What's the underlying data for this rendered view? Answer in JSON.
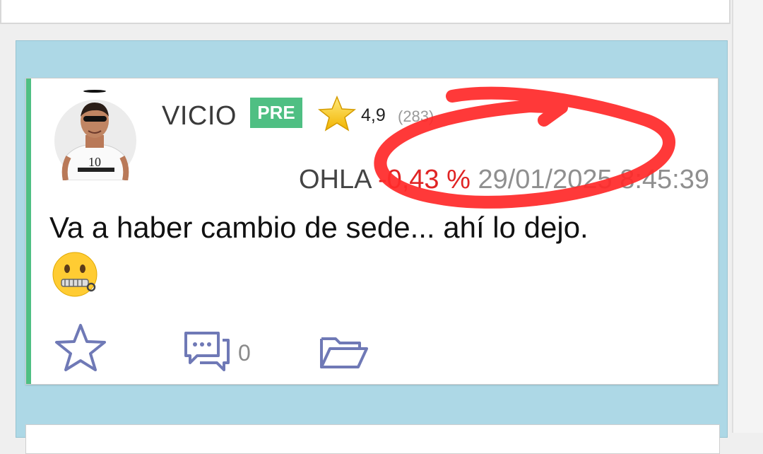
{
  "post": {
    "username": "VICIO",
    "badge": "PRE",
    "rating": "4,9",
    "reviews": "(283)",
    "ticker": "OHLA",
    "change": "-0,43 %",
    "timestamp": "29/01/2025 8:45:39",
    "message": "Va a haber cambio de sede... ahí lo dejo.",
    "emoji": "zipper-mouth-face",
    "comment_count": "0",
    "avatar_shirt_text": "10"
  },
  "colors": {
    "accent": "#4fbf83",
    "negative": "#e02424",
    "panel": "#add8e6",
    "annotation": "#ff2a2a"
  },
  "icons": [
    "star-rating-icon",
    "zipper-mouth-emoji-icon",
    "favorite-star-icon",
    "comments-icon",
    "folder-icon"
  ]
}
